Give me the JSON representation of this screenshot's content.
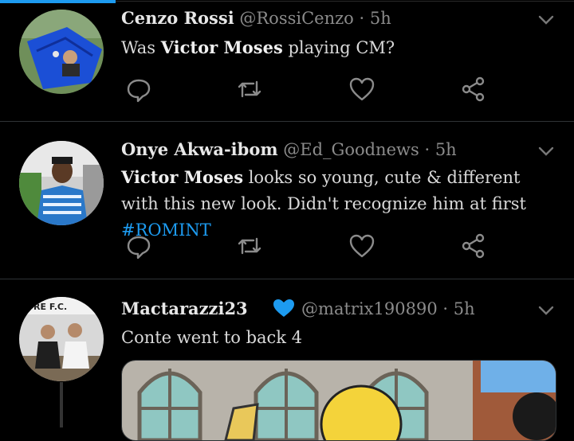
{
  "tweets": [
    {
      "name": "Cenzo Rossi",
      "handle": "@RossiCenzo",
      "time": "5h",
      "body_prefix": "Was ",
      "body_bold": "Victor Moses",
      "body_suffix": " playing CM?"
    },
    {
      "name": "Onye Akwa-ibom",
      "handle": "@Ed_Goodnews",
      "time": "5h",
      "body_bold": "Victor Moses",
      "body_suffix": " looks so young, cute & different with this new look. Didn't recognize him at first ",
      "hashtag": "#ROMINT"
    },
    {
      "name": "Mactarazzi23",
      "handle": "@matrix190890",
      "time": "5h",
      "body": "Conte went to back 4",
      "avatar_sign_text": "RE F.C."
    }
  ],
  "separator": "·",
  "colors": {
    "accent": "#1d9bf0",
    "background": "#000000",
    "muted": "#8b8b8b",
    "verified": "#1d9bf0"
  },
  "icons": [
    "reply-icon",
    "retweet-icon",
    "like-icon",
    "share-icon",
    "chevron-down-icon",
    "verified-icon"
  ]
}
